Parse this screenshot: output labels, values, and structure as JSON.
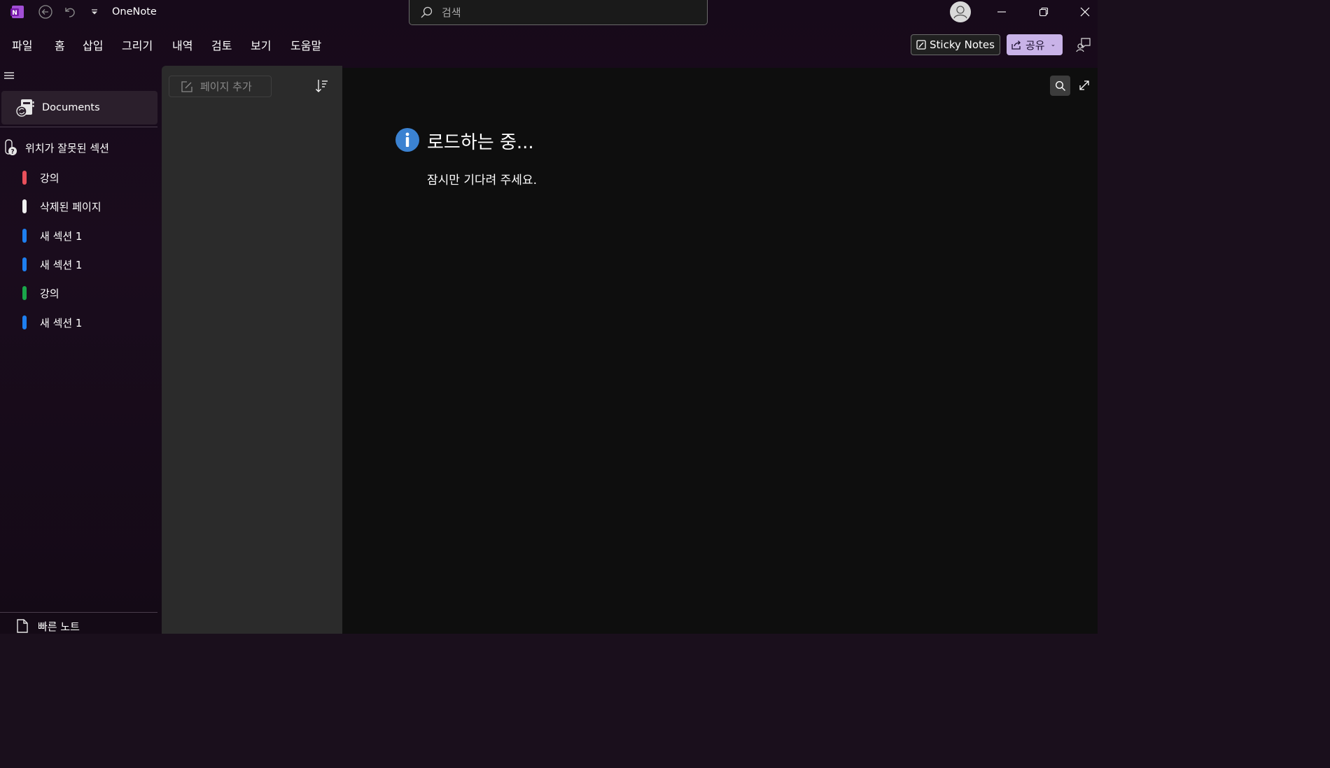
{
  "titlebar": {
    "app_title": "OneNote",
    "search_placeholder": "검색",
    "app_icon": "onenote-logo",
    "brand_color": "#7719aa"
  },
  "ribbon": {
    "tabs": [
      "파일",
      "홈",
      "삽입",
      "그리기",
      "내역",
      "검토",
      "보기",
      "도움말"
    ],
    "sticky_notes_label": "Sticky Notes",
    "share_label": "공유"
  },
  "nav": {
    "notebook_label": "Documents",
    "misplaced_label": "위치가 잘못된 섹션",
    "sections": [
      {
        "label": "강의",
        "color": "#e8505b"
      },
      {
        "label": "삭제된 페이지",
        "color": "#f0f0f0"
      },
      {
        "label": "새 섹션 1",
        "color": "#1e7ff0"
      },
      {
        "label": "새 섹션 1",
        "color": "#1e7ff0"
      },
      {
        "label": "강의",
        "color": "#1aa64a"
      },
      {
        "label": "새 섹션 1",
        "color": "#1e7ff0"
      }
    ],
    "quick_notes_label": "빠른 노트"
  },
  "pagelist": {
    "add_page_label": "페이지 추가"
  },
  "content": {
    "loading_title": "로드하는 중...",
    "loading_message": "잠시만 기다려 주세요.",
    "info_color": "#3b82d1"
  }
}
